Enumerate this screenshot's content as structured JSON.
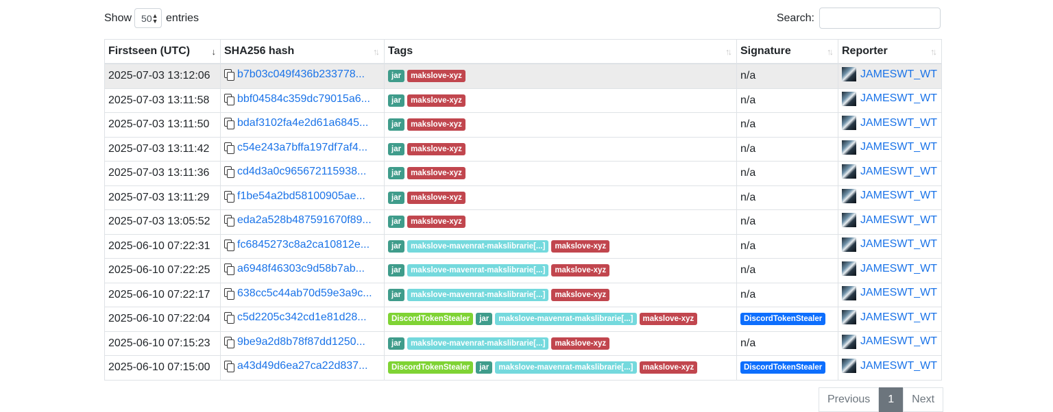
{
  "controls": {
    "show_label": "Show",
    "entries_value": "50",
    "entries_label": "entries",
    "search_label": "Search:",
    "search_value": ""
  },
  "table": {
    "columns": [
      "Firstseen (UTC)",
      "SHA256 hash",
      "Tags",
      "Signature",
      "Reporter"
    ],
    "rows": [
      {
        "firstseen": "2025-07-03 13:12:06",
        "hash": "b7b03c049f436b233778...",
        "tags": [
          "jar",
          "makslove-xyz"
        ],
        "signature": "n/a",
        "reporter": "JAMESWT_WT"
      },
      {
        "firstseen": "2025-07-03 13:11:58",
        "hash": "bbf04584c359dc79015a6...",
        "tags": [
          "jar",
          "makslove-xyz"
        ],
        "signature": "n/a",
        "reporter": "JAMESWT_WT"
      },
      {
        "firstseen": "2025-07-03 13:11:50",
        "hash": "bdaf3102fa4e2d61a6845...",
        "tags": [
          "jar",
          "makslove-xyz"
        ],
        "signature": "n/a",
        "reporter": "JAMESWT_WT"
      },
      {
        "firstseen": "2025-07-03 13:11:42",
        "hash": "c54e243a7bffa197df7af4...",
        "tags": [
          "jar",
          "makslove-xyz"
        ],
        "signature": "n/a",
        "reporter": "JAMESWT_WT"
      },
      {
        "firstseen": "2025-07-03 13:11:36",
        "hash": "cd4d3a0c965672115938...",
        "tags": [
          "jar",
          "makslove-xyz"
        ],
        "signature": "n/a",
        "reporter": "JAMESWT_WT"
      },
      {
        "firstseen": "2025-07-03 13:11:29",
        "hash": "f1be54a2bd58100905ae...",
        "tags": [
          "jar",
          "makslove-xyz"
        ],
        "signature": "n/a",
        "reporter": "JAMESWT_WT"
      },
      {
        "firstseen": "2025-07-03 13:05:52",
        "hash": "eda2a528b487591670f89...",
        "tags": [
          "jar",
          "makslove-xyz"
        ],
        "signature": "n/a",
        "reporter": "JAMESWT_WT"
      },
      {
        "firstseen": "2025-06-10 07:22:31",
        "hash": "fc6845273c8a2ca10812e...",
        "tags": [
          "jar",
          "makslove-mavenrat-makslibrarie[...]",
          "makslove-xyz"
        ],
        "signature": "n/a",
        "reporter": "JAMESWT_WT"
      },
      {
        "firstseen": "2025-06-10 07:22:25",
        "hash": "a6948f46303c9d58b7ab...",
        "tags": [
          "jar",
          "makslove-mavenrat-makslibrarie[...]",
          "makslove-xyz"
        ],
        "signature": "n/a",
        "reporter": "JAMESWT_WT"
      },
      {
        "firstseen": "2025-06-10 07:22:17",
        "hash": "638cc5c44ab70d59e3a9c...",
        "tags": [
          "jar",
          "makslove-mavenrat-makslibrarie[...]",
          "makslove-xyz"
        ],
        "signature": "n/a",
        "reporter": "JAMESWT_WT"
      },
      {
        "firstseen": "2025-06-10 07:22:04",
        "hash": "c5d2205c342cd1e81d28...",
        "tags": [
          "DiscordTokenStealer",
          "jar",
          "makslove-mavenrat-makslibrarie[...]",
          "makslove-xyz"
        ],
        "signature": "DiscordTokenStealer",
        "reporter": "JAMESWT_WT"
      },
      {
        "firstseen": "2025-06-10 07:15:23",
        "hash": "9be9a2d8b78f87dd1250...",
        "tags": [
          "jar",
          "makslove-mavenrat-makslibrarie[...]",
          "makslove-xyz"
        ],
        "signature": "n/a",
        "reporter": "JAMESWT_WT"
      },
      {
        "firstseen": "2025-06-10 07:15:00",
        "hash": "a43d49d6ea27ca22d837...",
        "tags": [
          "DiscordTokenStealer",
          "jar",
          "makslove-mavenrat-makslibrarie[...]",
          "makslove-xyz"
        ],
        "signature": "DiscordTokenStealer",
        "reporter": "JAMESWT_WT"
      }
    ]
  },
  "pagination": {
    "previous_label": "Previous",
    "current_page": "1",
    "next_label": "Next"
  },
  "tag_colors": {
    "jar": "#3f9c8b",
    "makslove-xyz": "#c1464e",
    "makslove-mavenrat-makslibrarie[...]": "#74d9dd",
    "DiscordTokenStealer": "#7fd334",
    "signature": "#0d6efd"
  }
}
